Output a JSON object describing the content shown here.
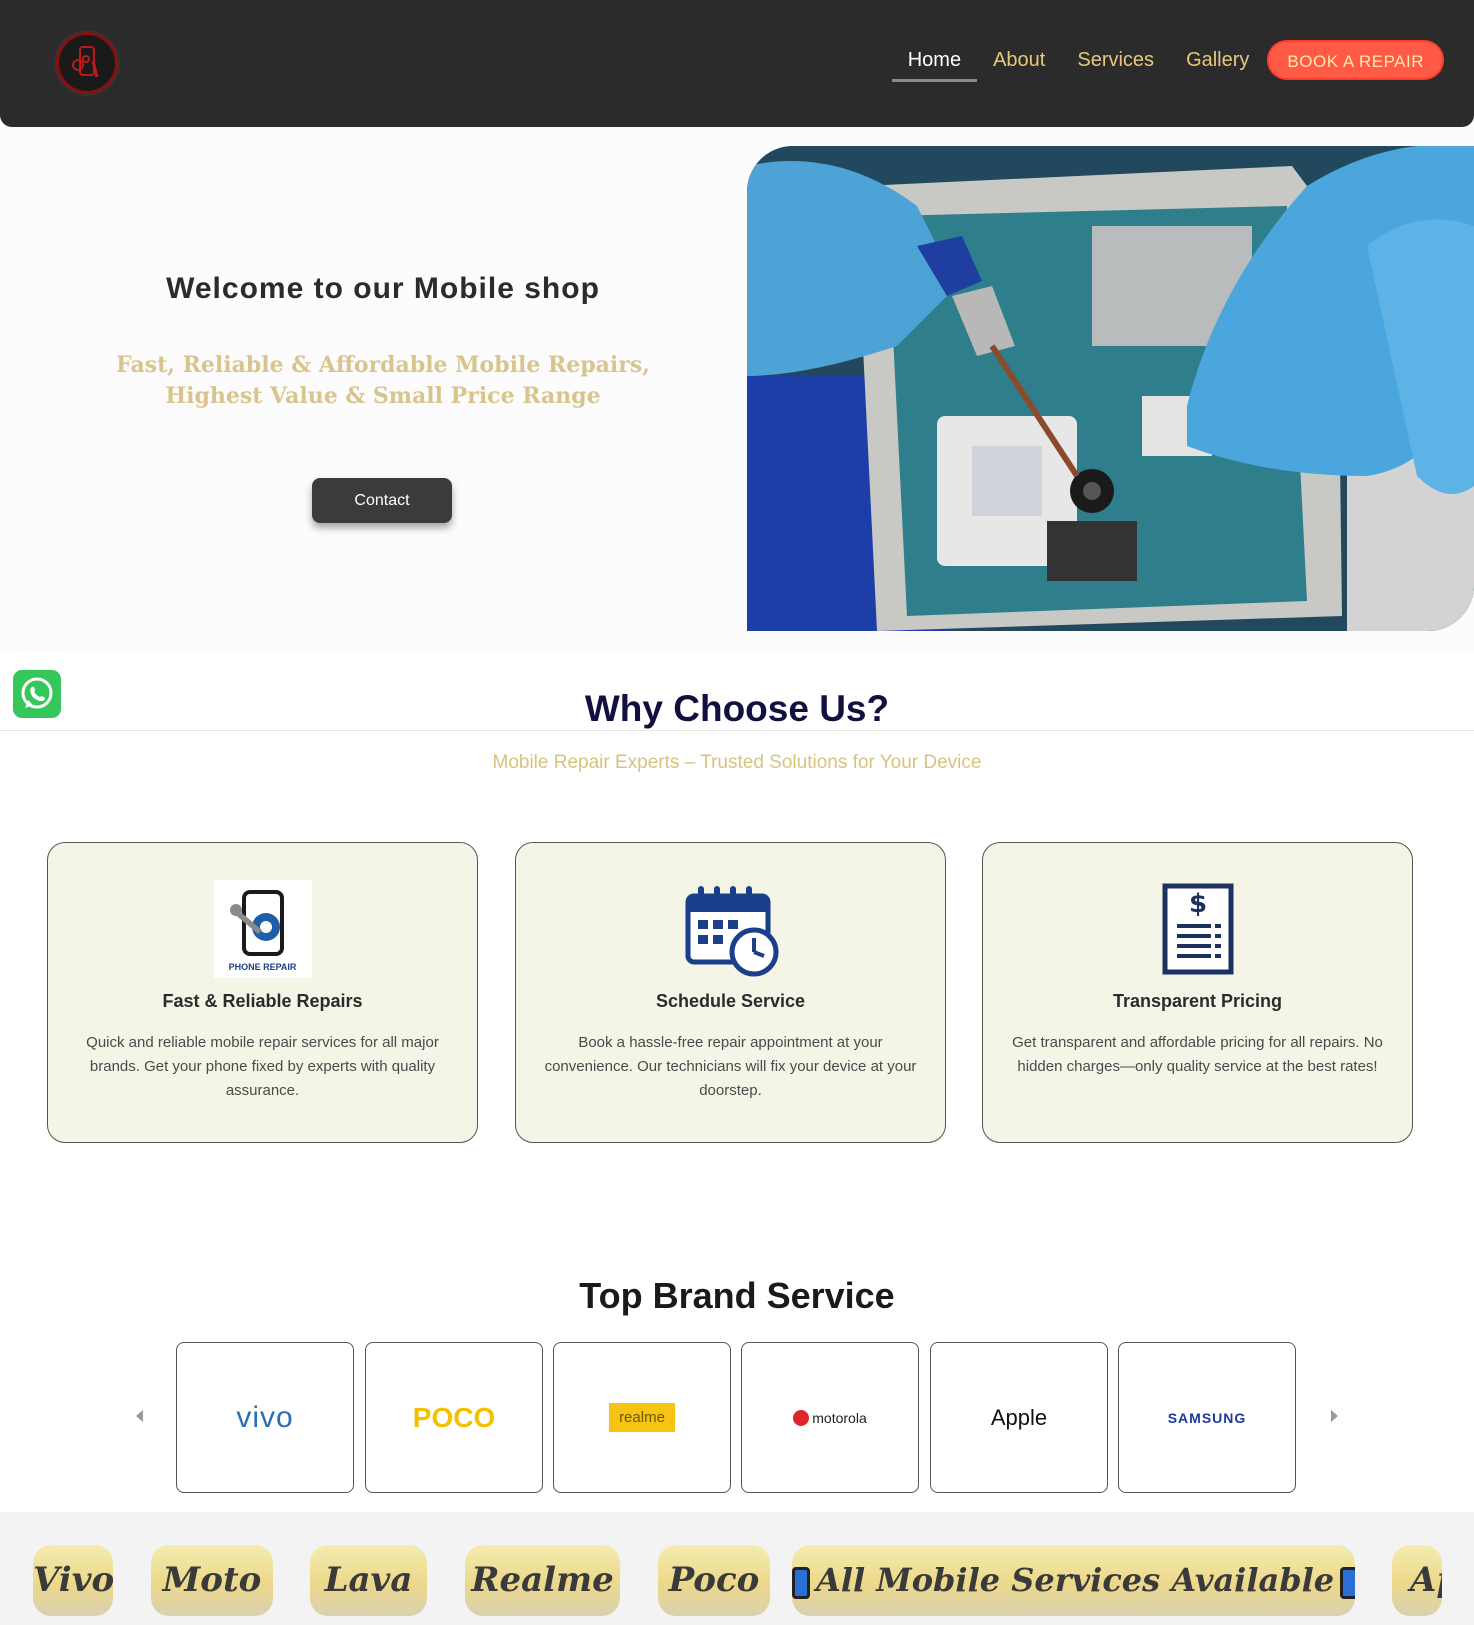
{
  "nav": {
    "links": [
      "Home",
      "About",
      "Services",
      "Gallery"
    ],
    "cta": "BOOK A REPAIR"
  },
  "hero": {
    "title": "Welcome to our Mobile shop",
    "subtitle_line1": "Fast, Reliable & Affordable Mobile Repairs,",
    "subtitle_line2": "Highest Value & Small Price Range",
    "button": "Contact"
  },
  "why": {
    "title": "Why Choose Us?",
    "subtitle": "Mobile Repair Experts – Trusted Solutions for Your Device",
    "cards": [
      {
        "icon_label": "PHONE REPAIR",
        "title": "Fast & Reliable Repairs",
        "text": "Quick and reliable mobile repair services for all major brands. Get your phone fixed by experts with quality assurance."
      },
      {
        "title": "Schedule Service",
        "text": "Book a hassle-free repair appointment at your convenience. Our technicians will fix your device at your doorstep."
      },
      {
        "title": "Transparent Pricing",
        "text": "Get transparent and affordable pricing for all repairs. No hidden charges—only quality service at the best rates!"
      }
    ]
  },
  "brands": {
    "title": "Top Brand Service",
    "logos": [
      "vivo",
      "POCO",
      "realme",
      "motorola",
      "Apple",
      "SAMSUNG"
    ]
  },
  "ticker": {
    "items": [
      "Vivo",
      "Moto",
      "Lava",
      "Realme",
      "Poco",
      "All Mobile Services Available",
      "Ap"
    ]
  },
  "colors": {
    "nav_bg": "#2b2b2b",
    "nav_link": "#e8c87a",
    "cta_bg": "#ff5a45",
    "accent_gold": "#d7c37f",
    "card_bg": "#f5f5e7",
    "heading_navy": "#121040",
    "whatsapp_green": "#34c759"
  }
}
